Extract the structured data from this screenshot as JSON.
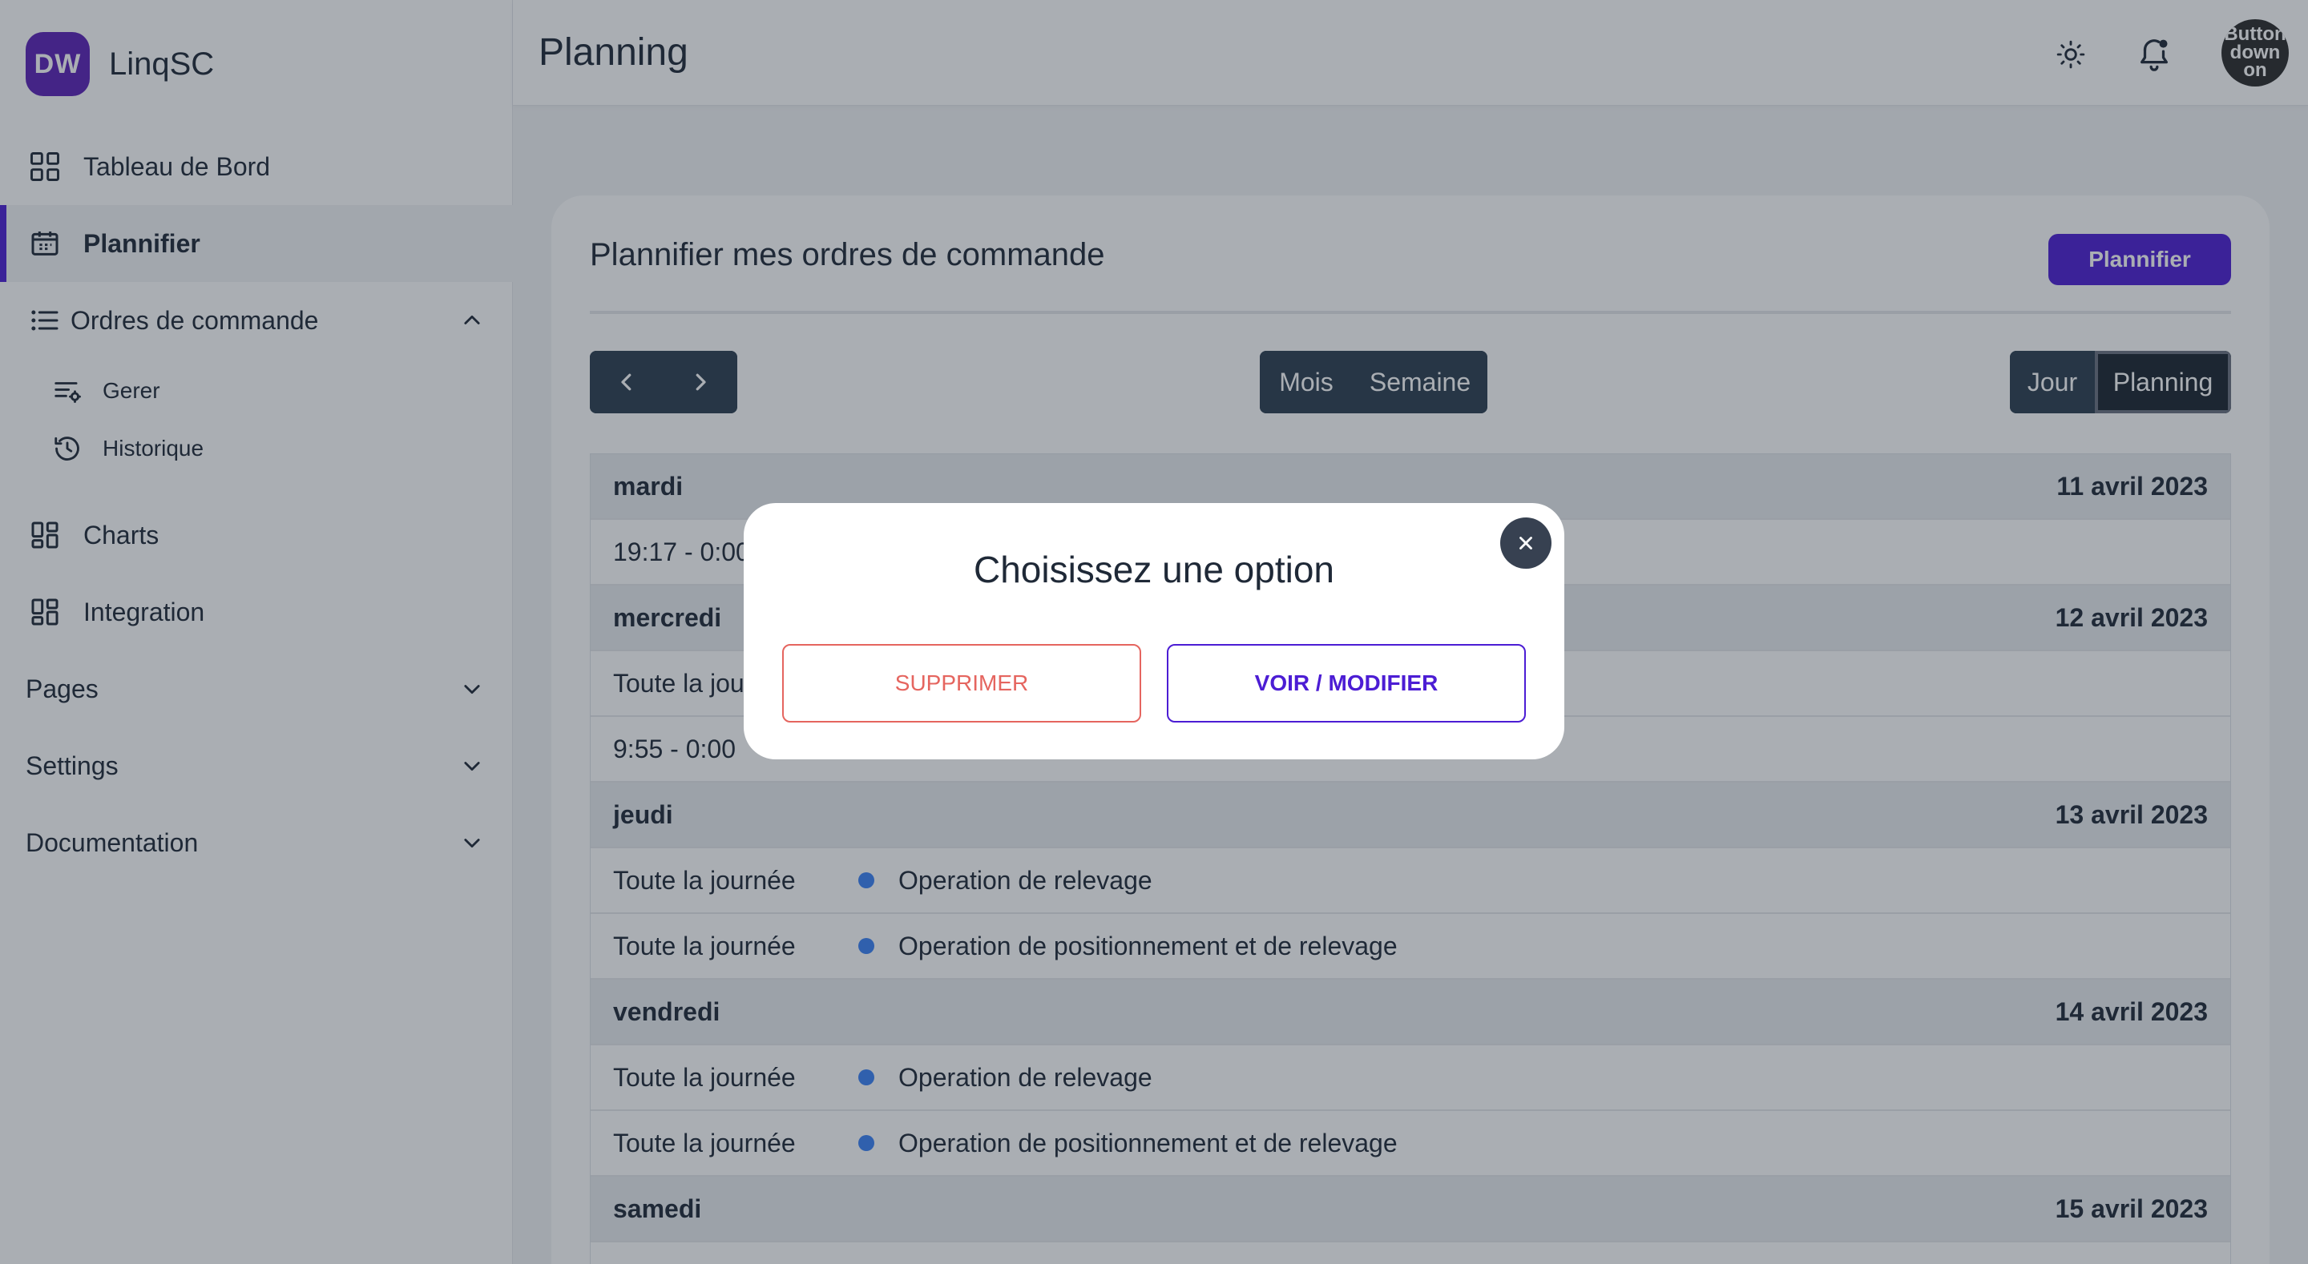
{
  "app": {
    "logo_initials": "DW",
    "name": "LinqSC"
  },
  "sidebar": {
    "items": [
      {
        "label": "Tableau de Bord",
        "icon": "grid-icon"
      },
      {
        "label": "Plannifier",
        "icon": "calendar-icon",
        "active": true
      },
      {
        "label": "Ordres de commande",
        "icon": "list-icon",
        "expanded": true
      },
      {
        "label": "Charts",
        "icon": "dashboard-icon"
      },
      {
        "label": "Integration",
        "icon": "dashboard-icon"
      },
      {
        "label": "Pages",
        "icon": "chevron-down-icon"
      },
      {
        "label": "Settings",
        "icon": "chevron-down-icon"
      },
      {
        "label": "Documentation",
        "icon": "chevron-down-icon"
      }
    ],
    "subitems": [
      {
        "label": "Gerer",
        "icon": "list-settings-icon"
      },
      {
        "label": "Historique",
        "icon": "history-icon"
      }
    ]
  },
  "header": {
    "title": "Planning",
    "avatar_text": "Button down on"
  },
  "card": {
    "title": "Plannifier mes ordres de commande",
    "plan_button": "Plannifier",
    "view_month": "Mois",
    "view_week": "Semaine",
    "view_day": "Jour",
    "view_planning": "Planning"
  },
  "schedule": [
    {
      "day": "mardi",
      "date": "11 avril 2023",
      "events": [
        {
          "time": "19:17 - 0:00",
          "title": ""
        }
      ]
    },
    {
      "day": "mercredi",
      "date": "12 avril 2023",
      "events": [
        {
          "time": "Toute la journée",
          "title": ""
        },
        {
          "time": "9:55 - 0:00",
          "title": ""
        }
      ]
    },
    {
      "day": "jeudi",
      "date": "13 avril 2023",
      "events": [
        {
          "time": "Toute la journée",
          "title": "Operation de relevage"
        },
        {
          "time": "Toute la journée",
          "title": "Operation de positionnement et de relevage"
        }
      ]
    },
    {
      "day": "vendredi",
      "date": "14 avril 2023",
      "events": [
        {
          "time": "Toute la journée",
          "title": "Operation de relevage"
        },
        {
          "time": "Toute la journée",
          "title": "Operation de positionnement et de relevage"
        }
      ]
    },
    {
      "day": "samedi",
      "date": "15 avril 2023",
      "events": []
    }
  ],
  "modal": {
    "title": "Choisissez une option",
    "delete_label": "SUPPRIMER",
    "edit_label": "VOIR / MODIFIER"
  },
  "colors": {
    "accent": "#4c1dd4",
    "danger": "#e5655f",
    "dark": "#2c3e50",
    "event_dot": "#3b82f6"
  }
}
